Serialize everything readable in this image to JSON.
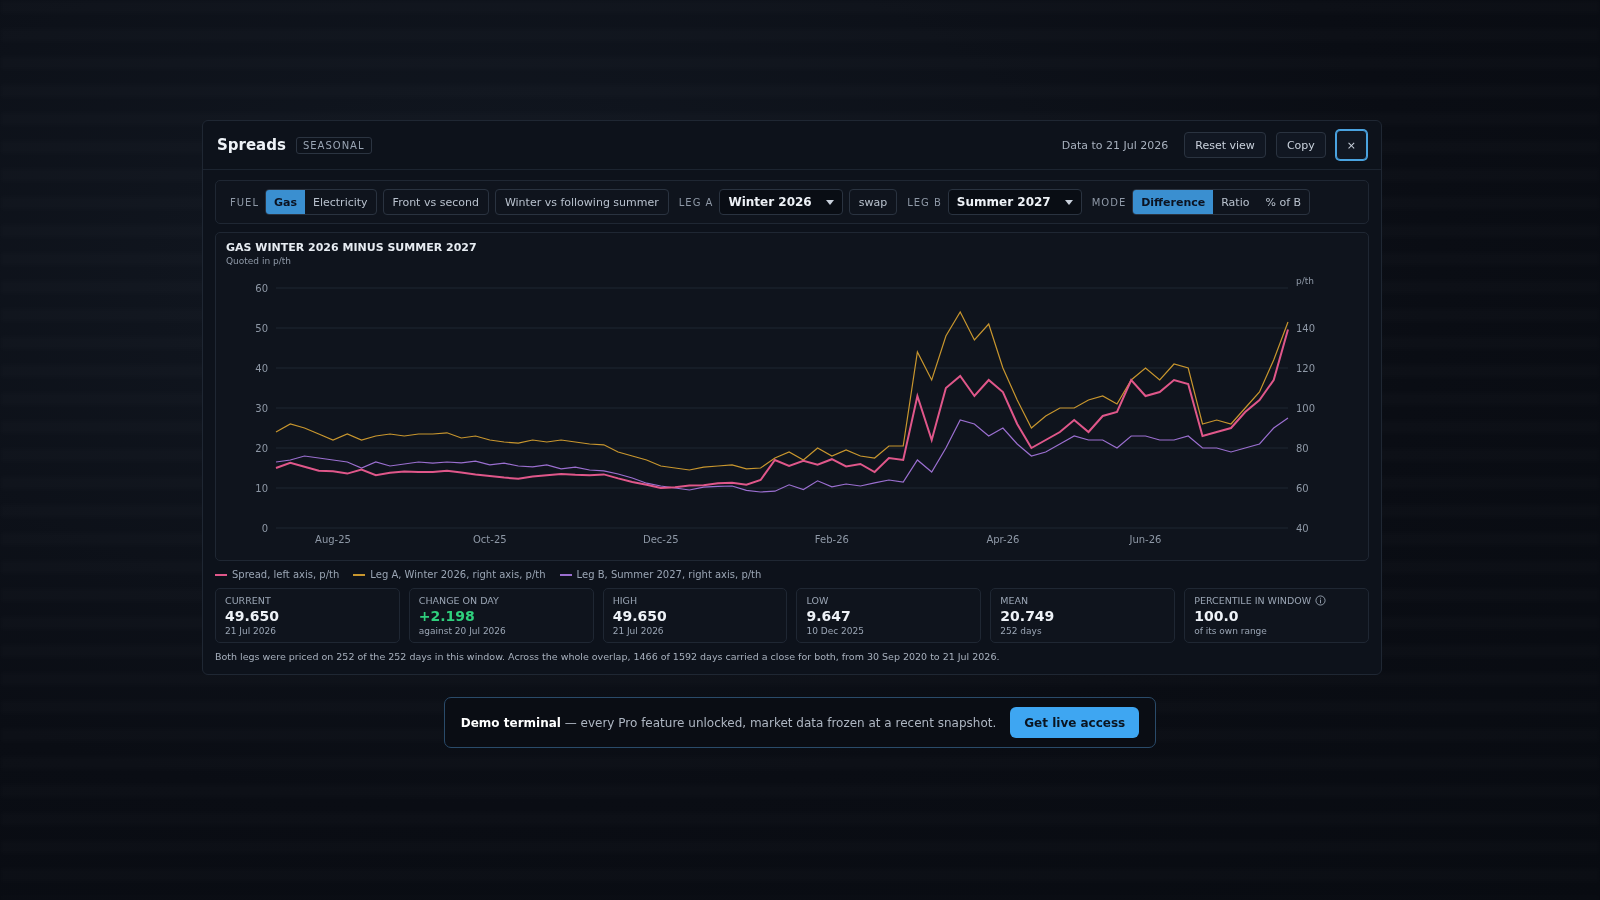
{
  "modal": {
    "title": "Spreads",
    "badge": "SEASONAL",
    "data_note": "Data to 21 Jul 2026",
    "buttons": [
      {
        "label": "Reset view",
        "kind": "text"
      },
      {
        "label": "Copy",
        "kind": "text"
      },
      {
        "label": "×",
        "kind": "close"
      }
    ]
  },
  "controls": [
    {
      "kind": "segmented",
      "label": "FUEL",
      "options": [
        {
          "label": "Gas",
          "selected": true
        },
        {
          "label": "Electricity",
          "selected": false
        }
      ]
    },
    {
      "kind": "button",
      "label": "Front vs second"
    },
    {
      "kind": "button",
      "label": "Winter vs following summer"
    },
    {
      "kind": "select",
      "label": "LEG A",
      "value": "Winter 2026"
    },
    {
      "kind": "button",
      "label": "swap"
    },
    {
      "kind": "select",
      "label": "LEG B",
      "value": "Summer 2027"
    },
    {
      "kind": "segmented",
      "label": "MODE",
      "options": [
        {
          "label": "Difference",
          "selected": true
        },
        {
          "label": "Ratio",
          "selected": false
        },
        {
          "label": "% of B",
          "selected": false
        }
      ]
    }
  ],
  "chart": {
    "title": "GAS WINTER 2026 MINUS SUMMER 2027",
    "subtitle": "Quoted in p/th",
    "right_axis": {
      "unit": "p/th",
      "ticks": [
        "140",
        "120",
        "100",
        "80",
        "60",
        "40"
      ]
    },
    "chart_data": {
      "type": "line",
      "categories": [
        null,
        null,
        null,
        null,
        "Aug-25",
        null,
        null,
        null,
        null,
        null,
        null,
        null,
        null,
        null,
        null,
        "Oct-25",
        null,
        null,
        null,
        null,
        null,
        null,
        null,
        null,
        null,
        null,
        null,
        "Dec-25",
        null,
        null,
        null,
        null,
        null,
        null,
        null,
        null,
        null,
        null,
        null,
        "Feb-26",
        null,
        null,
        null,
        null,
        null,
        null,
        null,
        null,
        null,
        null,
        null,
        "Apr-26",
        null,
        null,
        null,
        null,
        null,
        null,
        null,
        null,
        null,
        "Jun-26",
        null,
        null,
        null,
        null,
        null,
        null,
        null,
        null,
        null,
        null
      ],
      "ylim": [
        0,
        60
      ],
      "yticks": [
        0,
        10,
        20,
        30,
        40,
        50,
        60
      ],
      "grid": true,
      "series": [
        {
          "name": "Spread, left axis, p/th",
          "color": "#e0578a",
          "values": [
            15,
            16.3,
            15.3,
            14.3,
            14.2,
            13.6,
            14.6,
            13.2,
            13.8,
            14.1,
            14,
            14,
            14.3,
            13.9,
            13.4,
            13,
            12.6,
            12.3,
            12.9,
            13.2,
            13.5,
            13.3,
            13.2,
            13.4,
            12.4,
            11.5,
            10.8,
            10,
            10.2,
            10.6,
            10.7,
            11.2,
            11.3,
            10.8,
            12,
            17,
            15.5,
            16.8,
            15.8,
            17.2,
            15.4,
            16,
            14,
            17.5,
            17,
            33,
            22,
            35,
            38,
            33,
            37,
            34,
            26,
            20,
            22,
            24,
            27,
            24,
            28,
            29,
            37,
            33,
            34,
            37,
            36,
            23,
            24,
            25,
            29,
            32,
            37,
            49.6
          ]
        },
        {
          "name": "Leg A, Winter 2026, right axis, p/th",
          "color": "#c8962e",
          "values": [
            24,
            26,
            25,
            23.5,
            22,
            23.5,
            22,
            23,
            23.5,
            23,
            23.5,
            23.5,
            23.8,
            22.5,
            23,
            22,
            21.5,
            21.2,
            22,
            21.5,
            22,
            21.5,
            21,
            20.8,
            19,
            18,
            17,
            15.5,
            15,
            14.5,
            15.2,
            15.5,
            15.8,
            14.8,
            15,
            17.5,
            19,
            17,
            20,
            18,
            19.5,
            18,
            17.5,
            20.5,
            20.5,
            44,
            37,
            48,
            54,
            47,
            51,
            40,
            32,
            25,
            28,
            30,
            30,
            32,
            33,
            31,
            37,
            40,
            37,
            41,
            40,
            26,
            27,
            26,
            30,
            34,
            42,
            51.5
          ]
        },
        {
          "name": "Leg B, Summer 2027, right axis, p/th",
          "color": "#9b6fd0",
          "values": [
            16.5,
            17,
            18,
            17.5,
            17,
            16.5,
            15,
            16.5,
            15.5,
            16,
            16.5,
            16.2,
            16.5,
            16.3,
            16.7,
            15.8,
            16.2,
            15.5,
            15.3,
            15.8,
            14.8,
            15.2,
            14.5,
            14.3,
            13.5,
            12.5,
            11.2,
            10.5,
            10,
            9.5,
            10.2,
            10.4,
            10.5,
            9.4,
            9,
            9.2,
            10.8,
            9.6,
            11.8,
            10.3,
            11,
            10.5,
            11.3,
            12,
            11.5,
            17,
            14,
            20,
            27,
            26,
            23,
            25,
            21,
            18,
            19,
            21,
            23,
            22,
            22,
            20,
            23,
            23,
            22,
            22,
            23,
            20,
            20,
            19,
            20,
            21,
            25,
            27.5
          ]
        }
      ]
    }
  },
  "stats": [
    {
      "label": "CURRENT",
      "value": "49.650",
      "note": "21 Jul 2026",
      "color": "#eef2f7"
    },
    {
      "label": "CHANGE ON DAY",
      "value": "+2.198",
      "note": "against 20 Jul 2026",
      "color": "#2fd07d"
    },
    {
      "label": "HIGH",
      "value": "49.650",
      "note": "21 Jul 2026",
      "color": "#eef2f7"
    },
    {
      "label": "LOW",
      "value": "9.647",
      "note": "10 Dec 2025",
      "color": "#eef2f7"
    },
    {
      "label": "MEAN",
      "value": "20.749",
      "note": "252 days",
      "color": "#eef2f7"
    },
    {
      "label": "PERCENTILE IN WINDOW",
      "value": "100.0",
      "note": "of its own range",
      "color": "#eef2f7",
      "info": true
    }
  ],
  "footnote": "Both legs were priced on 252 of the 252 days in this window. Across the whole overlap, 1466 of 1592 days carried a close for both, from 30 Sep 2020 to 21 Jul 2026.",
  "banner": {
    "text": "**Demo terminal** — every Pro feature unlocked, market data frozen at a recent snapshot.",
    "button": "Get live access"
  }
}
